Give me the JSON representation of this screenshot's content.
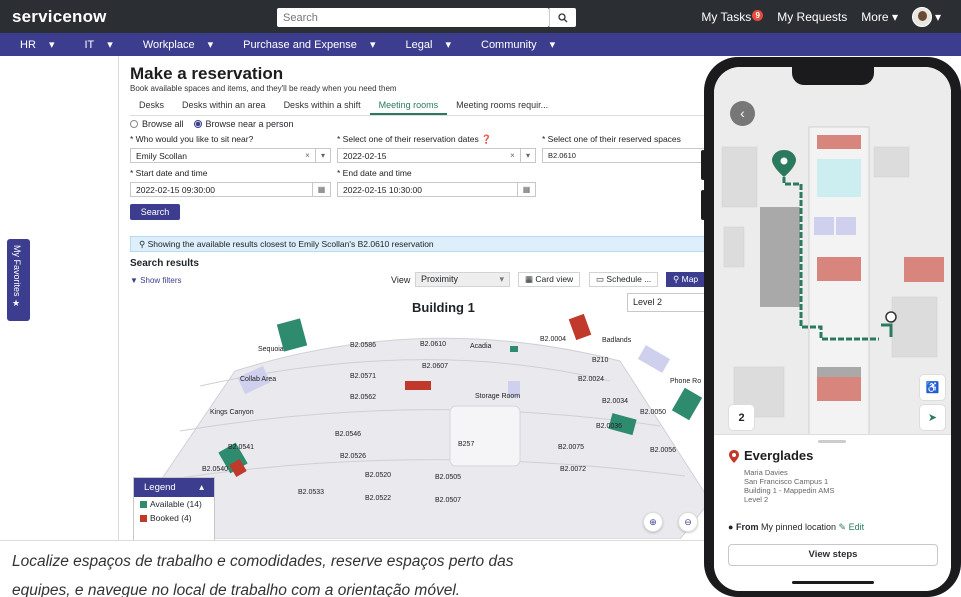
{
  "app": {
    "logo": "servicenow"
  },
  "topbar": {
    "search_placeholder": "Search",
    "my_tasks": "My Tasks",
    "my_tasks_count": "9",
    "my_requests": "My Requests",
    "more": "More"
  },
  "subnav": {
    "items": [
      "HR",
      "IT",
      "Workplace",
      "Purchase and Expense",
      "Legal",
      "Community"
    ]
  },
  "favorites": {
    "label": "My Favorites"
  },
  "page": {
    "title": "Make a reservation",
    "subtitle": "Book available spaces and items, and they'll be ready when you need them",
    "tabs": [
      "Desks",
      "Desks within an area",
      "Desks within a shift",
      "Meeting rooms",
      "Meeting rooms requir..."
    ],
    "active_tab": "Meeting rooms"
  },
  "form": {
    "browse_all": "Browse all",
    "browse_near": "Browse near a person",
    "who_label": "Who would you like to sit near?",
    "who_value": "Emily Scollan",
    "dates_label": "Select one of their reservation dates",
    "dates_value": "2022-02-15",
    "spaces_label": "Select one of their reserved spaces",
    "spaces_value": "B2.0610",
    "start_label": "Start date and time",
    "start_value": "2022-02-15 09:30:00",
    "end_label": "End date and time",
    "end_value": "2022-02-15 10:30:00",
    "search_button": "Search"
  },
  "results": {
    "info": "Showing the available results closest to Emily Scollan's B2.0610 reservation",
    "title": "Search results",
    "show_filters": "Show filters",
    "view_label": "View",
    "view_value": "Proximity",
    "card_view": "Card view",
    "schedule": "Schedule ...",
    "map": "Map",
    "building": "Building 1",
    "level": "Level 2"
  },
  "map_labels": [
    "B2.0610",
    "B2.0586",
    "B2.0607",
    "B2.0004",
    "Badlands",
    "Acadia",
    "Sequoia",
    "B210",
    "B2.0571",
    "Collab Area",
    "B2.0024",
    "Phone Ro",
    "B2.0562",
    "Storage Room",
    "B2.0034",
    "Kings Canyon",
    "B2.0050",
    "B2.0036",
    "B2.0546",
    "B257",
    "B2.0541",
    "B2.0075",
    "B2.0056",
    "B2.0526",
    "B2.0540",
    "B2.0072",
    "B2.0520",
    "B2.0505",
    "B2.0533",
    "B2.0522",
    "B2.0507"
  ],
  "legend": {
    "title": "Legend",
    "available": "Available (14)",
    "booked": "Booked (4)",
    "available_color": "#2e8b6e",
    "booked_color": "#c0392b"
  },
  "phone": {
    "level_badge": "2",
    "title": "Everglades",
    "person": "Maria Davies",
    "campus": "San Francisco Campus 1",
    "building": "Building 1 - Mappedin AMS",
    "level": "Level 2",
    "from_label": "From",
    "from_value": "My pinned location",
    "edit": "Edit",
    "view_steps": "View steps"
  },
  "caption": {
    "line1": "Localize espaços de trabalho e comodidades, reserve espaços perto das",
    "line2": "equipes, e navegue no local de trabalho com a orientação móvel."
  },
  "colors": {
    "topbar": "#2b2e33",
    "nav": "#3c3d8f",
    "accent": "#2b7a5e"
  }
}
